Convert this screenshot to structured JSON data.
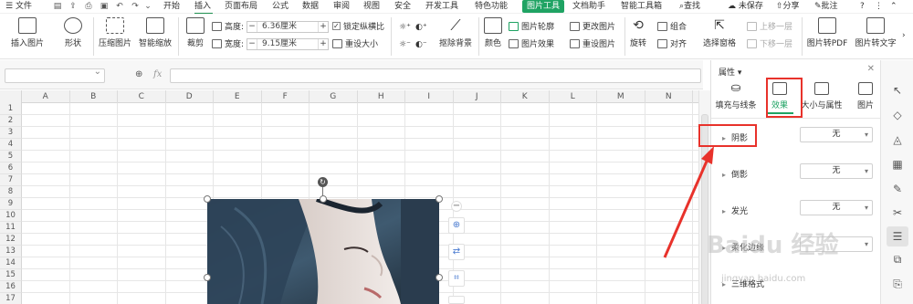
{
  "menubar": {
    "file": "文件",
    "tabs": [
      "开始",
      "插入",
      "页面布局",
      "公式",
      "数据",
      "审阅",
      "视图",
      "安全",
      "开发工具",
      "特色功能"
    ],
    "active_tab": "图片工具",
    "after_tabs": [
      "文档助手",
      "智能工具箱"
    ],
    "search": "查找",
    "unsaved": "未保存",
    "share": "分享",
    "comment": "批注",
    "help": "?"
  },
  "ribbon": {
    "insert_picture": "插入图片",
    "shape": "形状",
    "compress": "压缩图片",
    "smart_zoom": "智能缩放",
    "crop": "裁剪",
    "height_label": "高度:",
    "height_value": "6.36厘米",
    "width_label": "宽度:",
    "width_value": "9.15厘米",
    "lock_ratio": "锁定纵横比",
    "reset_size": "重设大小",
    "remove_bg": "抠除背景",
    "color": "颜色",
    "pic_outline": "图片轮廓",
    "pic_effect": "图片效果",
    "change_pic": "更改图片",
    "reset_pic": "重设图片",
    "rotate": "旋转",
    "group": "组合",
    "align": "对齐",
    "select_pane": "选择窗格",
    "bring_forward": "上移一层",
    "send_backward": "下移一层",
    "to_pdf": "图片转PDF",
    "to_text": "图片转文字"
  },
  "formula_bar": {
    "fx": "fx",
    "name_box": ""
  },
  "columns": [
    "A",
    "B",
    "C",
    "D",
    "E",
    "F",
    "G",
    "H",
    "I",
    "J",
    "K",
    "L",
    "M",
    "N"
  ],
  "rows": [
    "1",
    "2",
    "3",
    "4",
    "5",
    "6",
    "7",
    "8",
    "9",
    "10",
    "11",
    "12",
    "13",
    "14",
    "15",
    "16",
    "17"
  ],
  "panel": {
    "title": "属性",
    "tabs": [
      "填充与线条",
      "效果",
      "大小与属性",
      "图片"
    ],
    "selected_tab": "效果",
    "sections": [
      {
        "label": "阴影",
        "value": "无"
      },
      {
        "label": "倒影",
        "value": "无"
      },
      {
        "label": "发光",
        "value": "无"
      },
      {
        "label": "柔化边缘",
        "value": ""
      },
      {
        "label": "三维格式",
        "value": ""
      }
    ]
  },
  "watermark": {
    "text": "Baidu 经验",
    "url": "jingyan.baidu.com"
  },
  "colors": {
    "accent": "#1fa363",
    "highlight": "#e8322b"
  }
}
